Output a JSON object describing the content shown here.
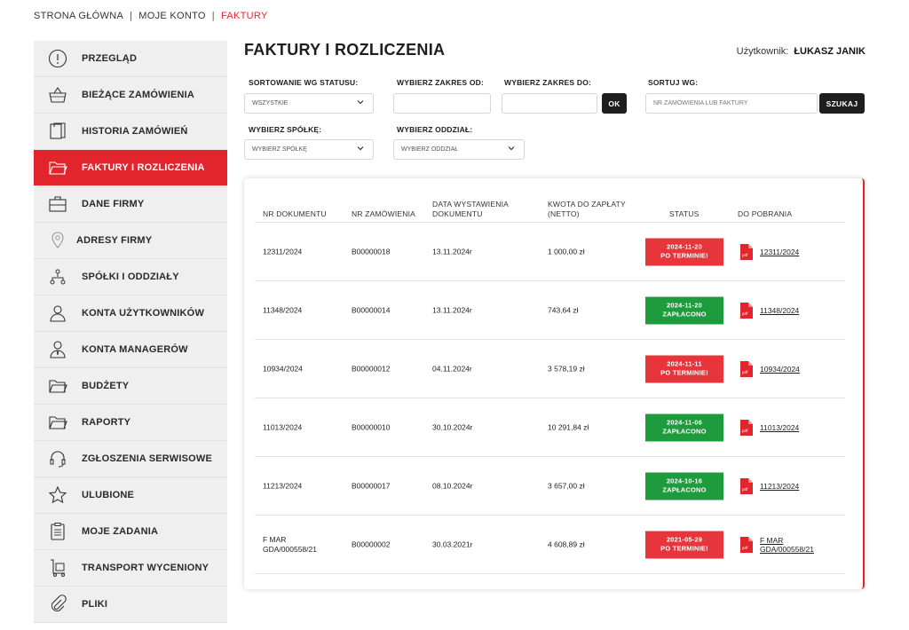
{
  "breadcrumb": {
    "home": "STRONA GŁÓWNA",
    "account": "MOJE KONTO",
    "current": "FAKTURY",
    "separator": "|"
  },
  "sidebar": {
    "items": [
      {
        "label": "PRZEGLĄD",
        "icon": "info-circle-icon"
      },
      {
        "label": "BIEŻĄCE ZAMÓWIENIA",
        "icon": "basket-icon"
      },
      {
        "label": "HISTORIA ZAMÓWIEŃ",
        "icon": "documents-icon"
      },
      {
        "label": "FAKTURY I ROZLICZENIA",
        "icon": "folder-icon"
      },
      {
        "label": "DANE FIRMY",
        "icon": "briefcase-icon"
      },
      {
        "label": "ADRESY FIRMY",
        "icon": "location-pin-icon"
      },
      {
        "label": "SPÓŁKI I ODDZIAŁY",
        "icon": "org-chart-icon"
      },
      {
        "label": "KONTA UŻYTKOWNIKÓW",
        "icon": "user-icon"
      },
      {
        "label": "KONTA MANAGERÓW",
        "icon": "manager-icon"
      },
      {
        "label": "BUDŻETY",
        "icon": "folder-icon"
      },
      {
        "label": "RAPORTY",
        "icon": "folder-icon"
      },
      {
        "label": "ZGŁOSZENIA SERWISOWE",
        "icon": "headset-icon"
      },
      {
        "label": "ULUBIONE",
        "icon": "star-icon"
      },
      {
        "label": "MOJE ZADANIA",
        "icon": "clipboard-icon"
      },
      {
        "label": "TRANSPORT WYCENIONY",
        "icon": "trolley-icon"
      },
      {
        "label": "PLIKI",
        "icon": "paperclip-icon"
      }
    ],
    "active_index": 3
  },
  "header": {
    "title": "FAKTURY I ROZLICZENIA",
    "user_label": "Użytkownik:",
    "user_name": "ŁUKASZ JANIK"
  },
  "filters": {
    "status_label": "SORTOWANIE WG STATUSU:",
    "status_value": "WSZYSTKIE",
    "date_from_label": "WYBIERZ ZAKRES OD:",
    "date_from_value": "",
    "date_to_label": "WYBIERZ ZAKRES DO:",
    "date_to_value": "",
    "ok_button": "OK",
    "sort_label": "SORTUJ WG:",
    "search_placeholder": "NR ZAMÓWIENIA LUB FAKTURY",
    "search_button": "SZUKAJ",
    "company_label": "WYBIERZ SPÓŁKĘ:",
    "company_value": "WYBIERZ SPÓŁKĘ",
    "branch_label": "WYBIERZ ODDZIAŁ:",
    "branch_value": "WYBIERZ ODDZIAŁ"
  },
  "table": {
    "columns": [
      "NR DOKUMENTU",
      "NR ZAMÓWIENIA",
      "DATA WYSTAWIENIA",
      "DOKUMENTU",
      "KWOTA DO ZAPŁATY",
      "(NETTO)",
      "STATUS",
      "DO POBRANIA"
    ],
    "rows": [
      {
        "doc": "12311/2024",
        "order": "B00000018",
        "date": "13.11.2024r",
        "amount": "1 000,00 zł",
        "status_date": "2024-11-20",
        "status_text": "PO TERMINIE!",
        "status_kind": "overdue",
        "download": "12311/2024"
      },
      {
        "doc": "11348/2024",
        "order": "B00000014",
        "date": "13.11.2024r",
        "amount": "743,64 zł",
        "status_date": "2024-11-20",
        "status_text": "ZAPŁACONO",
        "status_kind": "paid",
        "download": "11348/2024"
      },
      {
        "doc": "10934/2024",
        "order": "B00000012",
        "date": "04.11.2024r",
        "amount": "3 578,19 zł",
        "status_date": "2024-11-11",
        "status_text": "PO TERMINIE!",
        "status_kind": "overdue",
        "download": "10934/2024"
      },
      {
        "doc": "11013/2024",
        "order": "B00000010",
        "date": "30.10.2024r",
        "amount": "10 291,84 zł",
        "status_date": "2024-11-06",
        "status_text": "ZAPŁACONO",
        "status_kind": "paid",
        "download": "11013/2024"
      },
      {
        "doc": "11213/2024",
        "order": "B00000017",
        "date": "08.10.2024r",
        "amount": "3 657,00 zł",
        "status_date": "2024-10-16",
        "status_text": "ZAPŁACONO",
        "status_kind": "paid",
        "download": "11213/2024"
      },
      {
        "doc_line1": "F MAR",
        "doc_line2": "GDA/000558/21",
        "order": "B00000002",
        "date": "30.03.2021r",
        "amount": "4 608,89 zł",
        "status_date": "2021-05-29",
        "status_text": "PO TERMINIE!",
        "status_kind": "overdue",
        "download_line1": "F MAR",
        "download_line2": "GDA/000558/21"
      }
    ]
  },
  "colors": {
    "accent": "#e2242c",
    "overdue": "#e7353b",
    "paid": "#1e9b3c",
    "dark": "#1e1e1e",
    "sidebar_bg": "#efefef"
  }
}
